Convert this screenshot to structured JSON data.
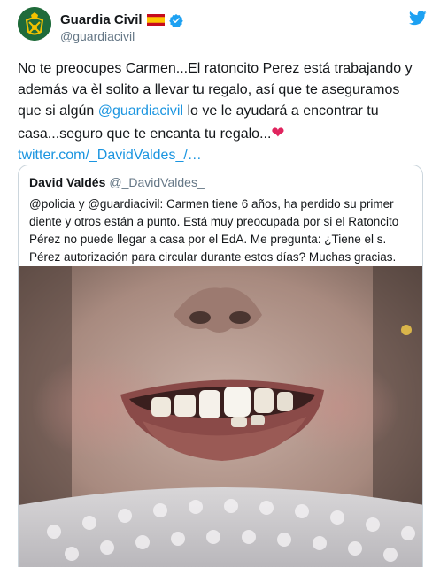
{
  "account": {
    "name": "Guardia Civil",
    "handle": "@guardiacivil"
  },
  "tweet": {
    "text_part1": "No te preocupes Carmen...El ratoncito Perez está trabajando y además va èl solito a llevar tu regalo, así que te aseguramos que si algún ",
    "mention": "@guardiacivil",
    "text_part2": " lo ve le ayudará a encontrar tu casa...seguro que te encanta tu regalo...",
    "heart": "❤",
    "link": "twitter.com/_DavidValdes_/…"
  },
  "quoted_tweet": {
    "name": "David Valdés",
    "handle": "@_DavidValdes_",
    "text": "@policia y @guardiacivil: Carmen tiene 6 años, ha perdido su primer diente y otros están a punto. Está muy preocupada por si el Ratoncito Pérez no puede llegar a casa por el EdA. Me pregunta: ¿Tiene el s. Pérez autorización para circular durante estos días? Muchas gracias."
  },
  "colors": {
    "link": "#1b95e0",
    "text": "#14171a",
    "muted": "#657786",
    "twitter_blue": "#1da1f2",
    "heart": "#e0245e"
  },
  "icons": [
    "guardia-civil-logo-icon",
    "spain-flag-icon",
    "verified-badge-icon",
    "twitter-bird-icon"
  ]
}
